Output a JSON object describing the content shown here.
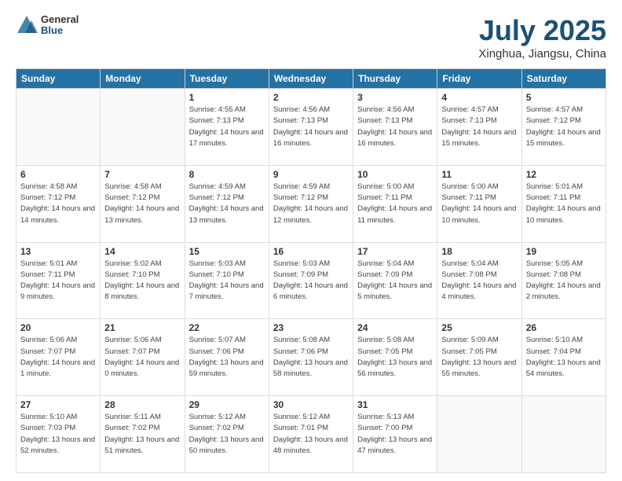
{
  "header": {
    "logo_general": "General",
    "logo_blue": "Blue",
    "month_title": "July 2025",
    "subtitle": "Xinghua, Jiangsu, China"
  },
  "weekdays": [
    "Sunday",
    "Monday",
    "Tuesday",
    "Wednesday",
    "Thursday",
    "Friday",
    "Saturday"
  ],
  "weeks": [
    [
      {
        "day": "",
        "info": ""
      },
      {
        "day": "",
        "info": ""
      },
      {
        "day": "1",
        "sunrise": "4:55 AM",
        "sunset": "7:13 PM",
        "daylight": "14 hours and 17 minutes."
      },
      {
        "day": "2",
        "sunrise": "4:56 AM",
        "sunset": "7:13 PM",
        "daylight": "14 hours and 16 minutes."
      },
      {
        "day": "3",
        "sunrise": "4:56 AM",
        "sunset": "7:13 PM",
        "daylight": "14 hours and 16 minutes."
      },
      {
        "day": "4",
        "sunrise": "4:57 AM",
        "sunset": "7:13 PM",
        "daylight": "14 hours and 15 minutes."
      },
      {
        "day": "5",
        "sunrise": "4:57 AM",
        "sunset": "7:12 PM",
        "daylight": "14 hours and 15 minutes."
      }
    ],
    [
      {
        "day": "6",
        "sunrise": "4:58 AM",
        "sunset": "7:12 PM",
        "daylight": "14 hours and 14 minutes."
      },
      {
        "day": "7",
        "sunrise": "4:58 AM",
        "sunset": "7:12 PM",
        "daylight": "14 hours and 13 minutes."
      },
      {
        "day": "8",
        "sunrise": "4:59 AM",
        "sunset": "7:12 PM",
        "daylight": "14 hours and 13 minutes."
      },
      {
        "day": "9",
        "sunrise": "4:59 AM",
        "sunset": "7:12 PM",
        "daylight": "14 hours and 12 minutes."
      },
      {
        "day": "10",
        "sunrise": "5:00 AM",
        "sunset": "7:11 PM",
        "daylight": "14 hours and 11 minutes."
      },
      {
        "day": "11",
        "sunrise": "5:00 AM",
        "sunset": "7:11 PM",
        "daylight": "14 hours and 10 minutes."
      },
      {
        "day": "12",
        "sunrise": "5:01 AM",
        "sunset": "7:11 PM",
        "daylight": "14 hours and 10 minutes."
      }
    ],
    [
      {
        "day": "13",
        "sunrise": "5:01 AM",
        "sunset": "7:11 PM",
        "daylight": "14 hours and 9 minutes."
      },
      {
        "day": "14",
        "sunrise": "5:02 AM",
        "sunset": "7:10 PM",
        "daylight": "14 hours and 8 minutes."
      },
      {
        "day": "15",
        "sunrise": "5:03 AM",
        "sunset": "7:10 PM",
        "daylight": "14 hours and 7 minutes."
      },
      {
        "day": "16",
        "sunrise": "5:03 AM",
        "sunset": "7:09 PM",
        "daylight": "14 hours and 6 minutes."
      },
      {
        "day": "17",
        "sunrise": "5:04 AM",
        "sunset": "7:09 PM",
        "daylight": "14 hours and 5 minutes."
      },
      {
        "day": "18",
        "sunrise": "5:04 AM",
        "sunset": "7:08 PM",
        "daylight": "14 hours and 4 minutes."
      },
      {
        "day": "19",
        "sunrise": "5:05 AM",
        "sunset": "7:08 PM",
        "daylight": "14 hours and 2 minutes."
      }
    ],
    [
      {
        "day": "20",
        "sunrise": "5:06 AM",
        "sunset": "7:07 PM",
        "daylight": "14 hours and 1 minute."
      },
      {
        "day": "21",
        "sunrise": "5:06 AM",
        "sunset": "7:07 PM",
        "daylight": "14 hours and 0 minutes."
      },
      {
        "day": "22",
        "sunrise": "5:07 AM",
        "sunset": "7:06 PM",
        "daylight": "13 hours and 59 minutes."
      },
      {
        "day": "23",
        "sunrise": "5:08 AM",
        "sunset": "7:06 PM",
        "daylight": "13 hours and 58 minutes."
      },
      {
        "day": "24",
        "sunrise": "5:08 AM",
        "sunset": "7:05 PM",
        "daylight": "13 hours and 56 minutes."
      },
      {
        "day": "25",
        "sunrise": "5:09 AM",
        "sunset": "7:05 PM",
        "daylight": "13 hours and 55 minutes."
      },
      {
        "day": "26",
        "sunrise": "5:10 AM",
        "sunset": "7:04 PM",
        "daylight": "13 hours and 54 minutes."
      }
    ],
    [
      {
        "day": "27",
        "sunrise": "5:10 AM",
        "sunset": "7:03 PM",
        "daylight": "13 hours and 52 minutes."
      },
      {
        "day": "28",
        "sunrise": "5:11 AM",
        "sunset": "7:02 PM",
        "daylight": "13 hours and 51 minutes."
      },
      {
        "day": "29",
        "sunrise": "5:12 AM",
        "sunset": "7:02 PM",
        "daylight": "13 hours and 50 minutes."
      },
      {
        "day": "30",
        "sunrise": "5:12 AM",
        "sunset": "7:01 PM",
        "daylight": "13 hours and 48 minutes."
      },
      {
        "day": "31",
        "sunrise": "5:13 AM",
        "sunset": "7:00 PM",
        "daylight": "13 hours and 47 minutes."
      },
      {
        "day": "",
        "info": ""
      },
      {
        "day": "",
        "info": ""
      }
    ]
  ]
}
